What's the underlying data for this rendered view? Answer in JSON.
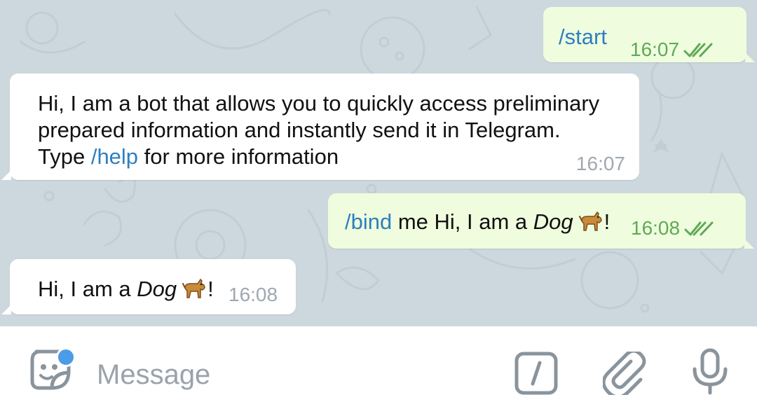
{
  "messages": [
    {
      "direction": "outgoing",
      "command": "/start",
      "time": "16:07",
      "status": "read"
    },
    {
      "direction": "incoming",
      "line1": "Hi, I am a bot that allows you to quickly access preliminary",
      "line2": "prepared information and instantly send it in Telegram.",
      "line3_pre": "Type ",
      "line3_cmd": "/help",
      "line3_post": " for more information",
      "time": "16:07"
    },
    {
      "direction": "outgoing",
      "command": "/bind",
      "text_pre": " me Hi, I am a ",
      "text_em": "Dog",
      "text_post": "!",
      "emoji": "dog",
      "time": "16:08",
      "status": "read"
    },
    {
      "direction": "incoming",
      "text_pre": "Hi, I am a ",
      "text_em": "Dog",
      "text_post": "!",
      "emoji": "dog",
      "time": "16:08"
    }
  ],
  "composer": {
    "placeholder": "Message",
    "icons": [
      "sticker-icon",
      "bot-command-icon",
      "attach-icon",
      "microphone-icon"
    ]
  },
  "colors": {
    "outgoing_bubble": "#effdde",
    "incoming_bubble": "#ffffff",
    "link": "#2e7fbf",
    "outgoing_time": "#5fa957",
    "incoming_time": "#a0a8b0",
    "notification_dot": "#4a9ce6"
  }
}
